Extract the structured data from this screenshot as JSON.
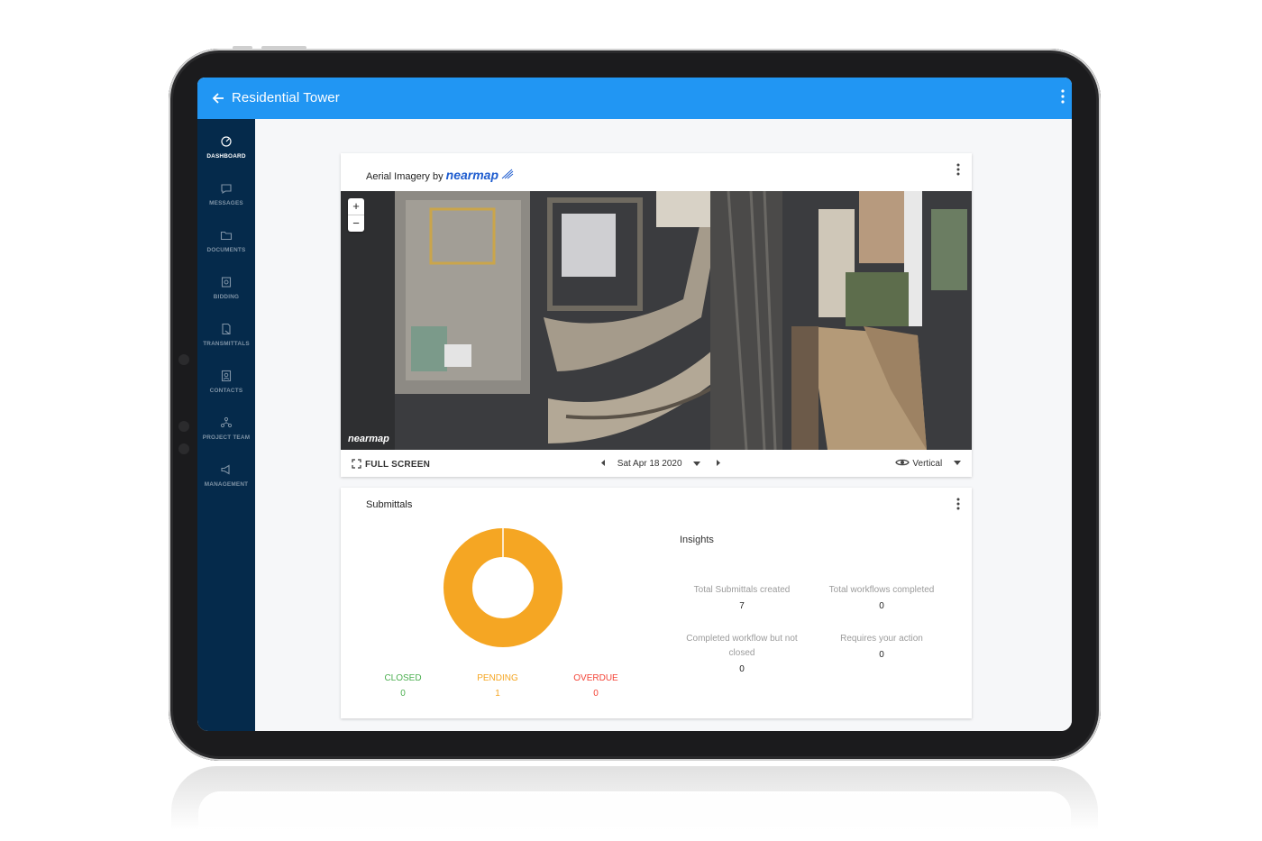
{
  "appbar": {
    "title": "Residential Tower"
  },
  "sidebar": {
    "items": [
      {
        "label": "DASHBOARD",
        "icon": "dashboard-icon",
        "active": true
      },
      {
        "label": "MESSAGES",
        "icon": "message-icon"
      },
      {
        "label": "DOCUMENTS",
        "icon": "folder-icon"
      },
      {
        "label": "BIDDING",
        "icon": "bidding-icon"
      },
      {
        "label": "TRANSMITTALS",
        "icon": "transmittal-icon"
      },
      {
        "label": "CONTACTS",
        "icon": "contacts-icon"
      },
      {
        "label": "PROJECT TEAM",
        "icon": "team-icon"
      },
      {
        "label": "MANAGEMENT",
        "icon": "megaphone-icon"
      }
    ]
  },
  "aerial": {
    "title": "Aerial Imagery by",
    "brand": "nearmap",
    "map_watermark": "nearmap",
    "zoom_in": "+",
    "zoom_out": "−",
    "fullscreen_label": "FULL SCREEN",
    "date": "Sat Apr 18 2020",
    "view_mode": "Vertical"
  },
  "submittals": {
    "title": "Submittals",
    "insights_title": "Insights",
    "legend": [
      {
        "label": "CLOSED",
        "value": "0",
        "color": "#4caf50"
      },
      {
        "label": "PENDING",
        "value": "1",
        "color": "#f5a623"
      },
      {
        "label": "OVERDUE",
        "value": "0",
        "color": "#f44336"
      }
    ],
    "insights": [
      {
        "label": "Total Submittals created",
        "value": "7"
      },
      {
        "label": "Total workflows completed",
        "value": "0"
      },
      {
        "label": "Completed workflow but not closed",
        "value": "0"
      },
      {
        "label": "Requires your action",
        "value": "0"
      }
    ]
  },
  "colors": {
    "accent": "#2196f3",
    "sidebar": "#052a4b",
    "pending": "#f5a623"
  }
}
